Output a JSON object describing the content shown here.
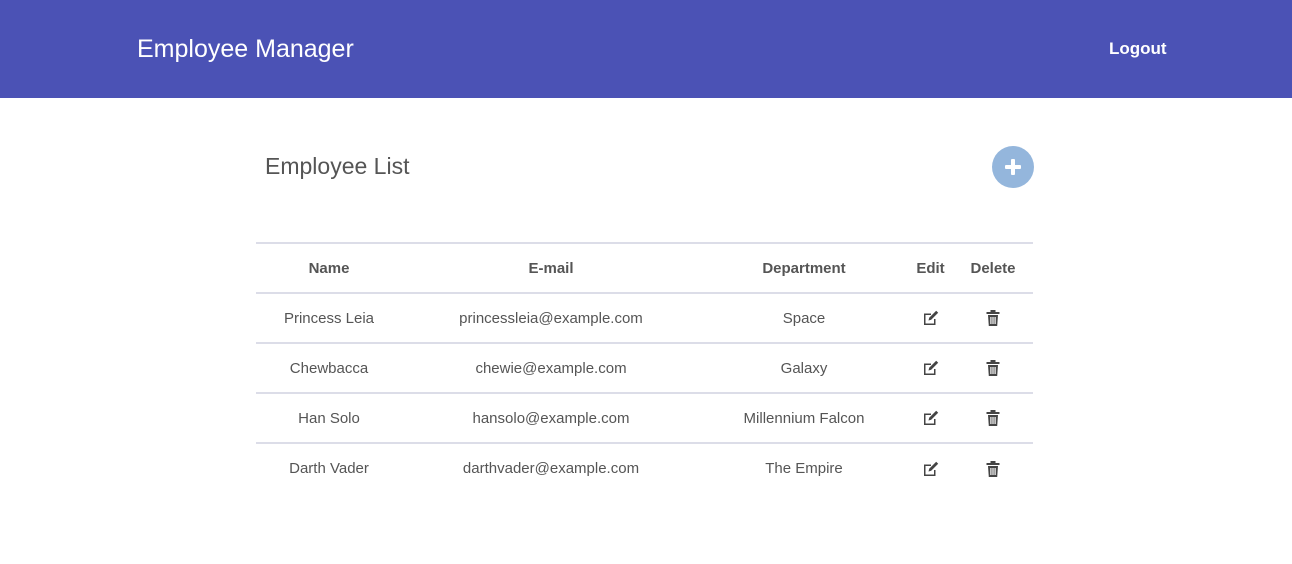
{
  "navbar": {
    "brand": "Employee Manager",
    "logout_label": "Logout",
    "background": "#4b52b5"
  },
  "main": {
    "title": "Employee List",
    "add_button_icon": "plus-icon",
    "add_button_color": "#94b6dc"
  },
  "table": {
    "headers": {
      "name": "Name",
      "email": "E-mail",
      "department": "Department",
      "edit": "Edit",
      "delete": "Delete"
    },
    "edit_icon": "edit-icon",
    "delete_icon": "trash-icon",
    "rows": [
      {
        "name": "Princess Leia",
        "email": "princessleia@example.com",
        "department": "Space"
      },
      {
        "name": "Chewbacca",
        "email": "chewie@example.com",
        "department": "Galaxy"
      },
      {
        "name": "Han Solo",
        "email": "hansolo@example.com",
        "department": "Millennium Falcon"
      },
      {
        "name": "Darth Vader",
        "email": "darthvader@example.com",
        "department": "The Empire"
      }
    ]
  }
}
